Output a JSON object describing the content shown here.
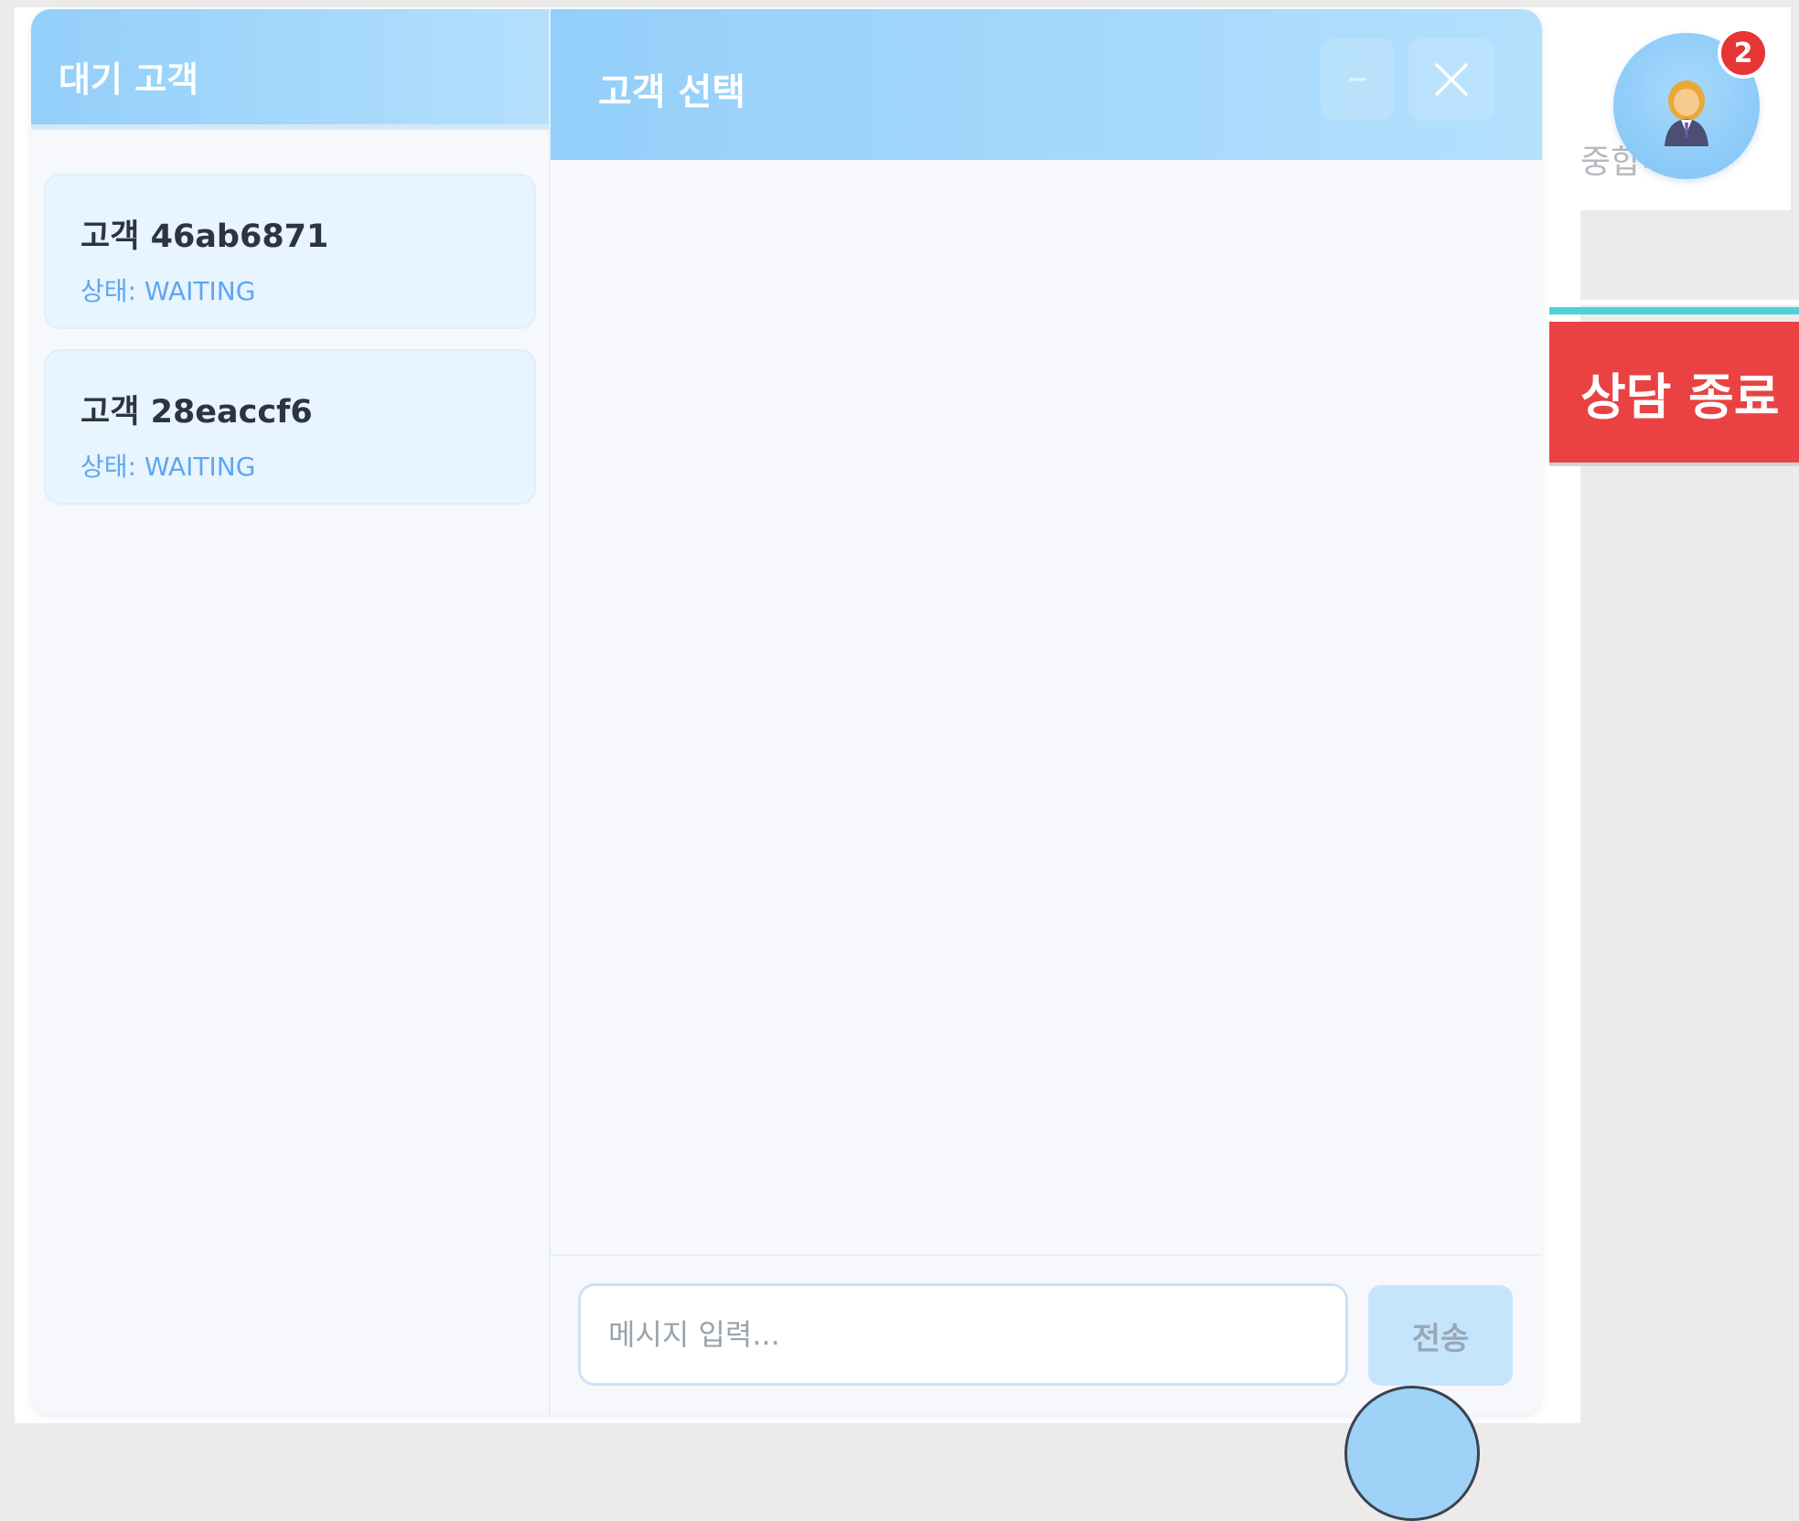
{
  "sidebar": {
    "title": "대기 고객",
    "customers": [
      {
        "name": "고객 46ab6871",
        "status": "상태: WAITING"
      },
      {
        "name": "고객 28eaccf6",
        "status": "상태: WAITING"
      }
    ]
  },
  "chat": {
    "title": "고객 선택",
    "minimize_icon": "minimize-icon",
    "close_icon": "close-icon",
    "input_placeholder": "메시지 입력...",
    "send_label": "전송"
  },
  "agent_widget": {
    "bubble_text": "중합니다.",
    "avatar_icon": "agent-avatar-icon",
    "badge_count": "2"
  },
  "end_consult": {
    "label": "상담 종료"
  },
  "colors": {
    "header_gradient_start": "#93cffa",
    "header_gradient_end": "#b4e0fd",
    "status_text": "#60a6f0",
    "badge": "#e53535",
    "end_button": "#ea4242",
    "send_button": "#c5e5fd"
  }
}
